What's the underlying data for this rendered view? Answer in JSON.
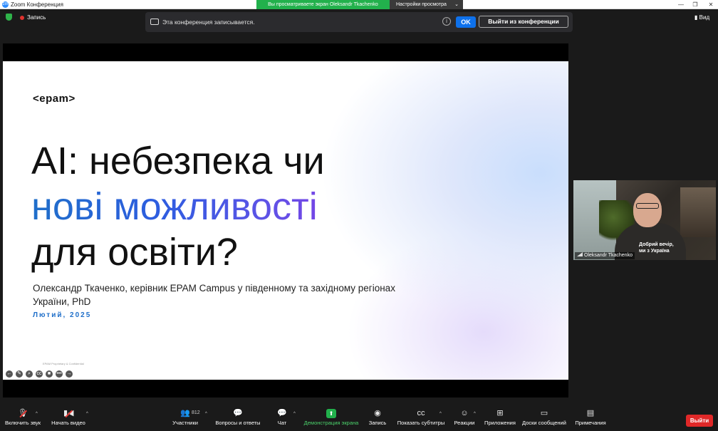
{
  "window": {
    "app_icon": "zm",
    "title": "Zoom Конференция",
    "share_banner": "Вы просматриваете экран Oleksandr Tkachenko",
    "view_options": "Настройки просмотра",
    "minimize": "—",
    "maximize": "❐",
    "close": "✕"
  },
  "topbar": {
    "recording_label": "Запись",
    "recording_notice": "Эта конференция записывается.",
    "info": "i",
    "ok_label": "OK",
    "leave_conference_label": "Выйти из конференции",
    "view_label": "Вид",
    "view_icon": "▮"
  },
  "slide": {
    "logo": "<epam>",
    "title_line1": "AI: небезпека чи",
    "title_line2": "нові можливості",
    "title_line3": "для освіти?",
    "author": "Олександр Ткаченко, керівник EPAM Campus у південному та західному регіонах України, PhD",
    "date": "Лютий, 2025",
    "footer": "EPAM Proprietary & Confidential",
    "tools": [
      "←",
      "✎",
      "⌕",
      "cc",
      "■",
      "•••",
      "→"
    ]
  },
  "video": {
    "name": "Oleksandr Tkachenko",
    "shirt_text": "Добрий вечір, ми з Україна"
  },
  "toolbar": {
    "mic_label": "Включить звук",
    "video_label": "Начать видео",
    "participants_label": "Участники",
    "participants_count": "812",
    "qa_label": "Вопросы и ответы",
    "chat_label": "Чат",
    "share_label": "Демонстрация экрана",
    "record_label": "Запись",
    "captions_label": "Показать субтитры",
    "reactions_label": "Реакции",
    "apps_label": "Приложения",
    "whiteboards_label": "Доски сообщений",
    "notes_label": "Примечания",
    "leave_label": "Выйти",
    "caret": "^",
    "icons": {
      "mic": "🎙",
      "video": "▮◀",
      "participants": "👥",
      "qa": "💬",
      "chat": "💬",
      "share": "⬆",
      "record": "◉",
      "captions": "cc",
      "reactions": "☺",
      "apps": "⊞",
      "whiteboards": "▭",
      "notes": "▤"
    }
  },
  "colors": {
    "accent_blue": "#0e71eb",
    "share_green": "#22b14c",
    "recording_red": "#e0322e",
    "leave_red": "#e02828"
  }
}
